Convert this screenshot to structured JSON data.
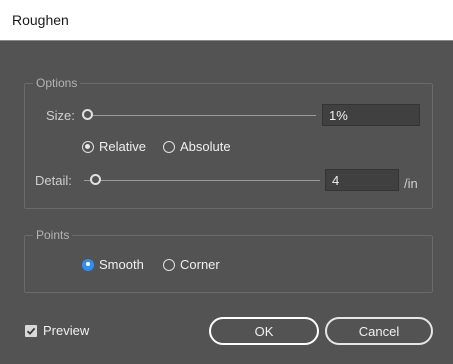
{
  "window": {
    "title": "Roughen"
  },
  "options": {
    "group_label": "Options",
    "size_label": "Size:",
    "size_value": "1%",
    "size_fraction": 0.01,
    "relative_label": "Relative",
    "absolute_label": "Absolute",
    "detail_label": "Detail:",
    "detail_value": "4",
    "detail_unit": "/in"
  },
  "points": {
    "group_label": "Points",
    "smooth_label": "Smooth",
    "corner_label": "Corner"
  },
  "footer": {
    "preview_label": "Preview",
    "ok_label": "OK",
    "cancel_label": "Cancel"
  },
  "colors": {
    "background": "#535353",
    "accent_blue": "#2f8ff0",
    "title_bar": "#ffffff"
  }
}
